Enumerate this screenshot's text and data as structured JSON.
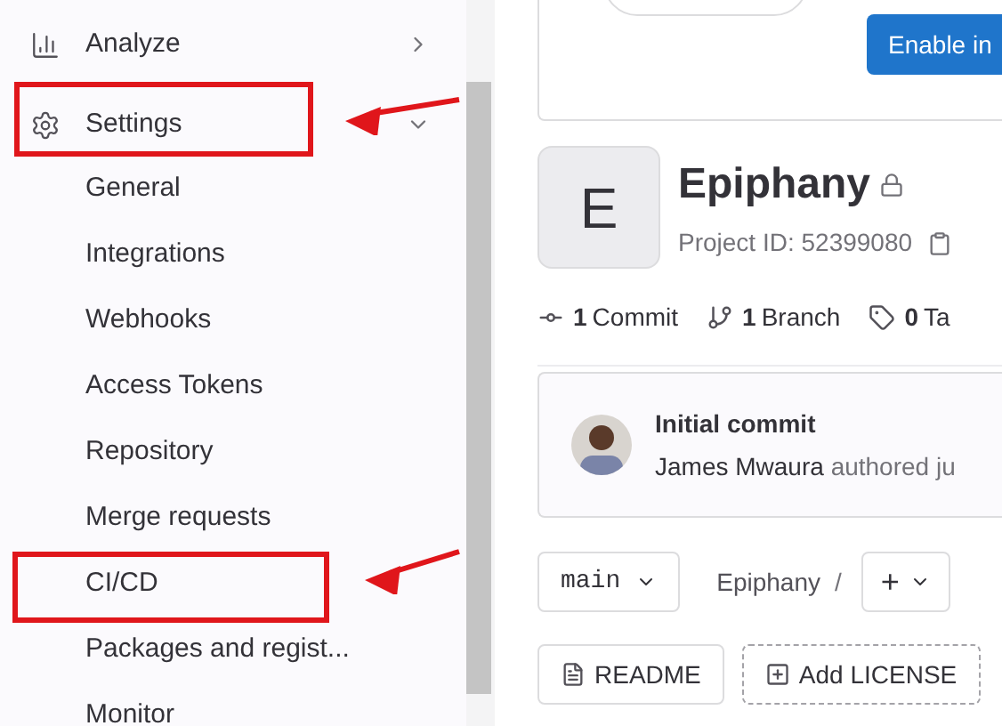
{
  "sidebar": {
    "items": [
      {
        "label": "Analyze",
        "expanded": false
      },
      {
        "label": "Settings",
        "expanded": true,
        "highlighted": true,
        "children": [
          {
            "label": "General",
            "highlighted": false
          },
          {
            "label": "Integrations",
            "highlighted": false
          },
          {
            "label": "Webhooks",
            "highlighted": false
          },
          {
            "label": "Access Tokens",
            "highlighted": false
          },
          {
            "label": "Repository",
            "highlighted": false
          },
          {
            "label": "Merge requests",
            "highlighted": false
          },
          {
            "label": "CI/CD",
            "highlighted": true
          },
          {
            "label": "Packages and regist...",
            "highlighted": false
          },
          {
            "label": "Monitor",
            "highlighted": false
          }
        ]
      }
    ]
  },
  "banner": {
    "button": "Enable in"
  },
  "project": {
    "initial": "E",
    "name": "Epiphany",
    "private": true,
    "id_text": "Project ID: 52399080",
    "stats": [
      {
        "kind": "commit",
        "count": "1",
        "label": "Commit"
      },
      {
        "kind": "branch",
        "count": "1",
        "label": "Branch"
      },
      {
        "kind": "tag",
        "count": "0",
        "label": "Ta"
      }
    ]
  },
  "last_commit": {
    "title": "Initial commit",
    "author": "James Mwaura",
    "action": "authored ju"
  },
  "repo_bar": {
    "branch": "main",
    "path": "Epiphany",
    "separator": "/",
    "add": "+"
  },
  "file_buttons": [
    {
      "kind": "file",
      "label": "README"
    },
    {
      "kind": "add",
      "label": "Add LICENSE"
    }
  ]
}
